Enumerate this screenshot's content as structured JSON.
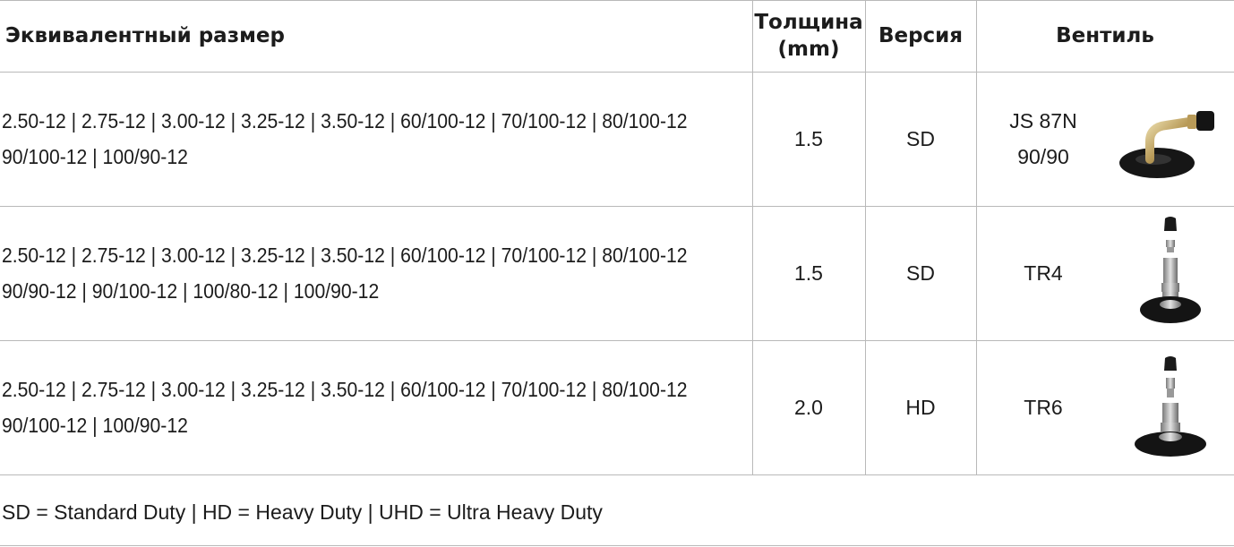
{
  "headers": {
    "size": "Эквивалентный размер",
    "thickness_line1": "Толщина",
    "thickness_line2": "(mm)",
    "version": "Версия",
    "valve": "Вентиль"
  },
  "rows": [
    {
      "sizes_line1": "2.50-12 | 2.75-12 | 3.00-12 | 3.25-12 | 3.50-12 | 60/100-12 | 70/100-12 | 80/100-12",
      "sizes_line2": "90/100-12 | 100/90-12",
      "thickness": "1.5",
      "version": "SD",
      "valve_line1": "JS 87N",
      "valve_line2": "90/90",
      "valve_icon": "bent-valve-icon"
    },
    {
      "sizes_line1": "2.50-12 | 2.75-12 | 3.00-12 | 3.25-12 | 3.50-12 | 60/100-12 | 70/100-12 | 80/100-12",
      "sizes_line2": "90/90-12 | 90/100-12 | 100/80-12 | 100/90-12",
      "thickness": "1.5",
      "version": "SD",
      "valve_line1": "TR4",
      "valve_line2": "",
      "valve_icon": "straight-valve-icon"
    },
    {
      "sizes_line1": "2.50-12 | 2.75-12 | 3.00-12 | 3.25-12 | 3.50-12 | 60/100-12 | 70/100-12 | 80/100-12",
      "sizes_line2": "90/100-12 | 100/90-12",
      "thickness": "2.0",
      "version": "HD",
      "valve_line1": "TR6",
      "valve_line2": "",
      "valve_icon": "straight-valve-icon"
    }
  ],
  "footer": "SD = Standard Duty | HD = Heavy Duty | UHD = Ultra Heavy Duty"
}
